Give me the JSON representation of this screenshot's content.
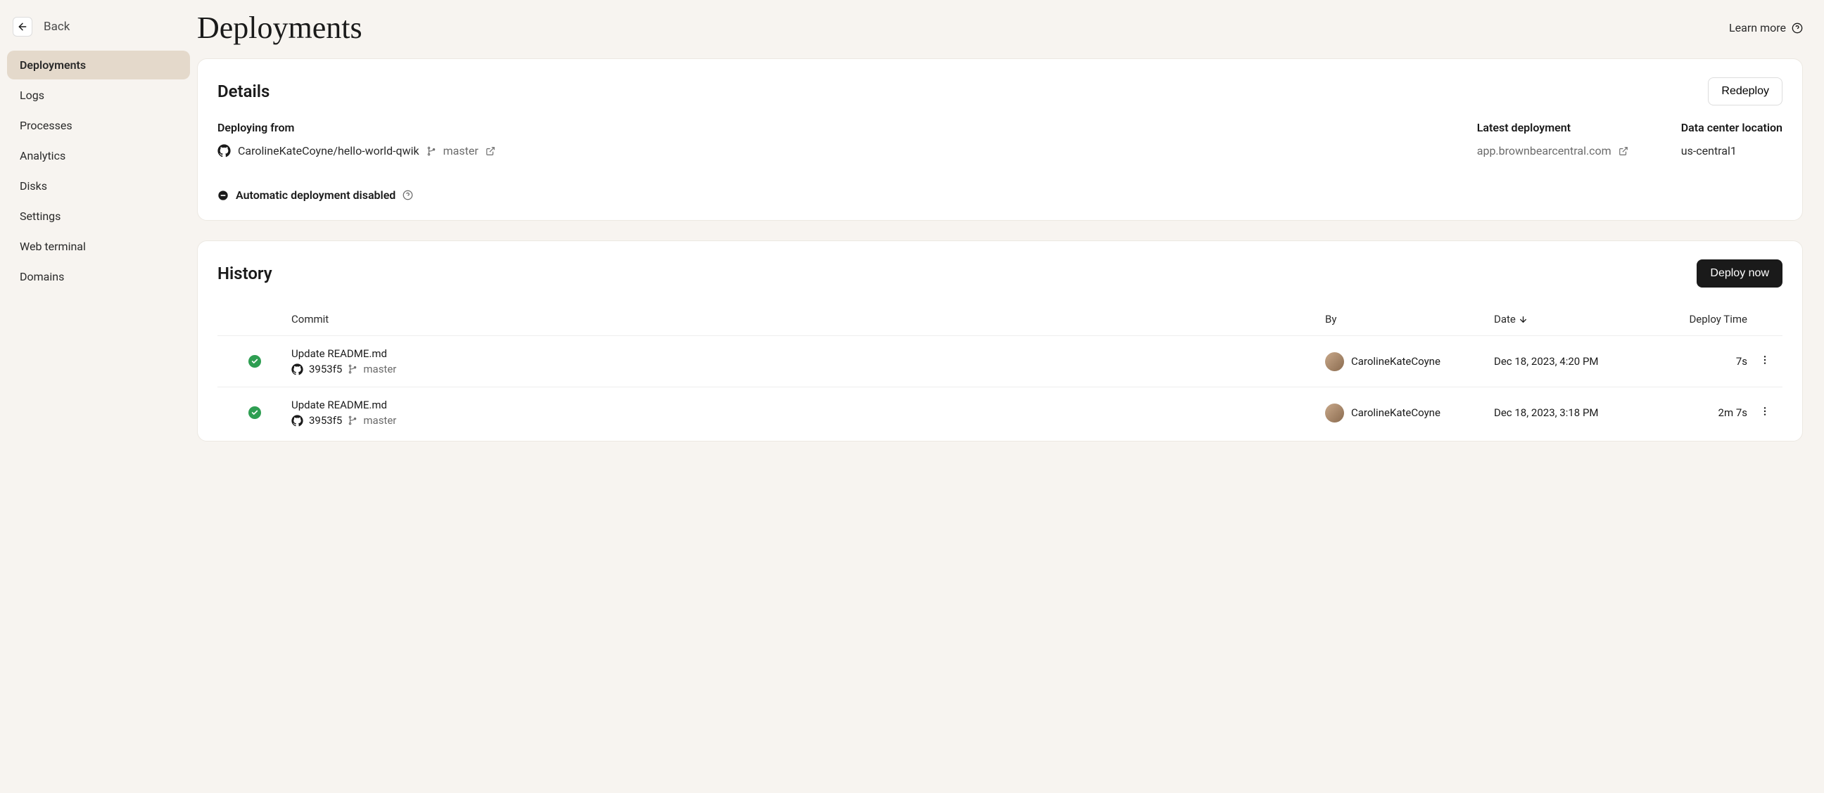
{
  "sidebar": {
    "back": "Back",
    "items": [
      "Deployments",
      "Logs",
      "Processes",
      "Analytics",
      "Disks",
      "Settings",
      "Web terminal",
      "Domains"
    ]
  },
  "header": {
    "title": "Deployments",
    "learn_more": "Learn more"
  },
  "details": {
    "title": "Details",
    "redeploy": "Redeploy",
    "deploying_from_label": "Deploying from",
    "repo": "CarolineKateCoyne/hello-world-qwik",
    "branch": "master",
    "latest_deployment_label": "Latest deployment",
    "latest_deployment_url": "app.brownbearcentral.com",
    "data_center_label": "Data center location",
    "data_center_value": "us-central1",
    "auto_deploy": "Automatic deployment disabled"
  },
  "history": {
    "title": "History",
    "deploy_now": "Deploy now",
    "columns": {
      "commit": "Commit",
      "by": "By",
      "date": "Date",
      "deploy_time": "Deploy Time"
    },
    "rows": [
      {
        "message": "Update README.md",
        "hash": "3953f5",
        "branch": "master",
        "by": "CarolineKateCoyne",
        "date": "Dec 18, 2023, 4:20 PM",
        "deploy_time": "7s"
      },
      {
        "message": "Update README.md",
        "hash": "3953f5",
        "branch": "master",
        "by": "CarolineKateCoyne",
        "date": "Dec 18, 2023, 3:18 PM",
        "deploy_time": "2m 7s"
      }
    ]
  }
}
